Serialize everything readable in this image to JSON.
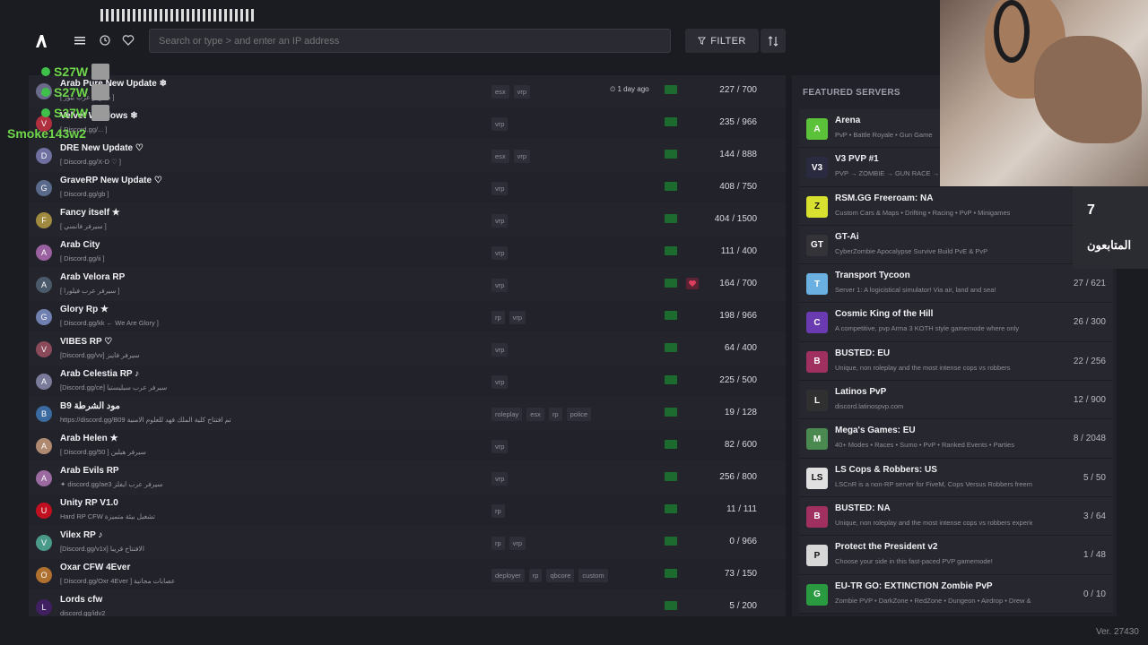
{
  "search": {
    "placeholder": "Search or type > and enter an IP address"
  },
  "toolbar": {
    "filter_label": "FILTER"
  },
  "servers": [
    {
      "name": "Arab Pure New Update ❄",
      "desc": "[ سيرفر عرب بيور ]",
      "tags": [
        "esx",
        "vrp"
      ],
      "ago": "1 day ago",
      "players": "227 / 700",
      "fav": false,
      "icon_color": "#6a6a8a",
      "icon": "A"
    },
    {
      "name": "Velvet Windows ❄",
      "desc": "[ Discord.gg/... ]",
      "tags": [
        "vrp"
      ],
      "ago": "",
      "players": "235 / 966",
      "fav": false,
      "icon_color": "#b03040",
      "icon": "V"
    },
    {
      "name": "DRE New Update ♡",
      "desc": "[ Discord.gg/X-D ♡ ]",
      "tags": [
        "esx",
        "vrp"
      ],
      "ago": "",
      "players": "144 / 888",
      "fav": false,
      "icon_color": "#6f6fa0",
      "icon": "D"
    },
    {
      "name": "GraveRP New Update ♡",
      "desc": "[ Discord.gg/gb ]",
      "tags": [
        "vrp"
      ],
      "ago": "",
      "players": "408 / 750",
      "fav": false,
      "icon_color": "#5a6a8a",
      "icon": "G"
    },
    {
      "name": "Fancy itself ★",
      "desc": "[ سيرفر فانسي ]",
      "tags": [
        "vrp"
      ],
      "ago": "",
      "players": "404 / 1500",
      "fav": false,
      "icon_color": "#a08a40",
      "icon": "F"
    },
    {
      "name": "Arab City",
      "desc": "[ Discord.gg/ii ]",
      "tags": [
        "vrp"
      ],
      "ago": "",
      "players": "111 / 400",
      "fav": false,
      "icon_color": "#9a60a0",
      "icon": "A"
    },
    {
      "name": "Arab Velora RP",
      "desc": "[ سيرفر عرب فيلورا ]",
      "tags": [
        "vrp"
      ],
      "ago": "",
      "players": "164 / 700",
      "fav": true,
      "icon_color": "#4a5a6a",
      "icon": "A"
    },
    {
      "name": "Glory Rp ★",
      "desc": "[ Discord.gg/kk ← We Are Glory ]",
      "tags": [
        "rp",
        "vrp"
      ],
      "ago": "",
      "players": "198 / 966",
      "fav": false,
      "icon_color": "#7080b0",
      "icon": "G"
    },
    {
      "name": "VIBES RP ♡",
      "desc": "[Discord.gg/vv] سيرفر فايبز",
      "tags": [
        "vrp"
      ],
      "ago": "",
      "players": "64 / 400",
      "fav": false,
      "icon_color": "#8a4a5a",
      "icon": "V"
    },
    {
      "name": "Arab Celestia RP ♪",
      "desc": "[Discord.gg/ce] سيرفر عرب سيليستيا",
      "tags": [
        "vrp"
      ],
      "ago": "",
      "players": "225 / 500",
      "fav": false,
      "icon_color": "#7a7a9a",
      "icon": "A"
    },
    {
      "name": "B9 مود الشرطة",
      "desc": "https://discord.gg/B09 تم افتتاح كلية الملك فهد للعلوم الامنية",
      "tags": [
        "roleplay",
        "esx",
        "rp",
        "police"
      ],
      "ago": "",
      "players": "19 / 128",
      "fav": false,
      "icon_color": "#3a6aa0",
      "icon": "B"
    },
    {
      "name": "Arab Helen ★",
      "desc": "[ Discord.gg/50 ] سيرفر هيلين",
      "tags": [
        "vrp"
      ],
      "ago": "",
      "players": "82 / 600",
      "fav": false,
      "icon_color": "#b08a70",
      "icon": "A"
    },
    {
      "name": "Arab Evils RP",
      "desc": "✦ discord.gg/ae3 سيرفر عرب ايفلز",
      "tags": [
        "vrp"
      ],
      "ago": "",
      "players": "256 / 800",
      "fav": false,
      "icon_color": "#9a6aa0",
      "icon": "A"
    },
    {
      "name": "Unity RP V1.0",
      "desc": "Hard RP CFW تشغيل بيئة متميزة",
      "tags": [
        "rp"
      ],
      "ago": "",
      "players": "11 / 111",
      "fav": false,
      "icon_color": "#c01020",
      "icon": "U"
    },
    {
      "name": "Vilex RP ♪",
      "desc": "[Discord.gg/v1x] الافتتاح قريبا",
      "tags": [
        "rp",
        "vrp"
      ],
      "ago": "",
      "players": "0 / 966",
      "fav": false,
      "icon_color": "#4a9a8a",
      "icon": "V"
    },
    {
      "name": "Oxar CFW 4Ever",
      "desc": "[ Discord.gg/Oxr 4Ever ] عصابات مجانية",
      "tags": [
        "deployer",
        "rp",
        "qbcore",
        "custom"
      ],
      "ago": "",
      "players": "73 / 150",
      "fav": false,
      "icon_color": "#b07030",
      "icon": "O"
    },
    {
      "name": "Lords cfw",
      "desc": "discord.gg/idv2",
      "tags": [],
      "ago": "",
      "players": "5 / 200",
      "fav": false,
      "icon_color": "#402060",
      "icon": "L"
    }
  ],
  "featured": {
    "title": "FEATURED SERVERS",
    "items": [
      {
        "name": "Arena",
        "desc": "PvP • Battle Royale • Gun Game",
        "players": "",
        "icon": "A",
        "icon_color": "#5cc23a"
      },
      {
        "name": "V3 PVP #1",
        "desc": "PVP → ZOMBIE → GUN RACE →",
        "players": "",
        "icon": "V3",
        "icon_color": "#2a2a40"
      },
      {
        "name": "RSM.GG Freeroam: NA",
        "desc": "Custom Cars & Maps • Drifting • Racing • PvP • Minigames",
        "players": "67",
        "icon": "Z",
        "icon_color": "#d8e030"
      },
      {
        "name": "GT-Ai",
        "desc": "CyberZombie Apocalypse Survive Build PvE & PvP",
        "players": "",
        "icon": "GT",
        "icon_color": "#333338"
      },
      {
        "name": "Transport Tycoon",
        "desc": "Server 1: A logicistical simulator! Via air, land and sea!",
        "players": "27 / 621",
        "icon": "T",
        "icon_color": "#6ab0e0"
      },
      {
        "name": "Cosmic King of the Hill",
        "desc": "A competitive, pvp Arma 3 KOTH style gamemode where only",
        "players": "26 / 300",
        "icon": "C",
        "icon_color": "#6a3ab0"
      },
      {
        "name": "BUSTED: EU",
        "desc": "Unique, non roleplay and the most intense cops vs robbers",
        "players": "22 / 256",
        "icon": "B",
        "icon_color": "#a03060"
      },
      {
        "name": "Latinos PvP",
        "desc": "discord.latinospvp.com",
        "players": "12 / 900",
        "icon": "L",
        "icon_color": "#303030"
      },
      {
        "name": "Mega's Games: EU",
        "desc": "40+ Modes • Races • Sumo • PvP • Ranked Events • Parties",
        "players": "8 / 2048",
        "icon": "M",
        "icon_color": "#4a8a50"
      },
      {
        "name": "LS Cops & Robbers: US",
        "desc": "LSCnR is a non-RP server for FiveM, Cops Versus Robbers freemode",
        "players": "5 / 50",
        "icon": "LS",
        "icon_color": "#e0e0e0"
      },
      {
        "name": "BUSTED: NA",
        "desc": "Unique, non roleplay and the most intense cops vs robbers experience",
        "players": "3 / 64",
        "icon": "B",
        "icon_color": "#a03060"
      },
      {
        "name": "Protect the President v2",
        "desc": "Choose your side in this fast-paced PVP gamemode!",
        "players": "1 / 48",
        "icon": "P",
        "icon_color": "#d8d8d8"
      },
      {
        "name": "EU-TR GO: EXTINCTION Zombie PvP",
        "desc": "Zombie PVP • DarkZone • RedZone • Dungeon • Airdrop • Drew & Sell",
        "players": "0 / 10",
        "icon": "G",
        "icon_color": "#2a9a40"
      }
    ]
  },
  "version": "Ver. 27430",
  "stream": {
    "followers_count": "7",
    "followers_label": "المتابعون",
    "chat": [
      {
        "user": "S27W",
        "color": "#6fd84a"
      },
      {
        "user": "S27W",
        "color": "#6fd84a"
      },
      {
        "user": "S27W",
        "color": "#6fd84a"
      },
      {
        "user": "Smoke143w2",
        "color": "#6fd84a"
      }
    ]
  }
}
